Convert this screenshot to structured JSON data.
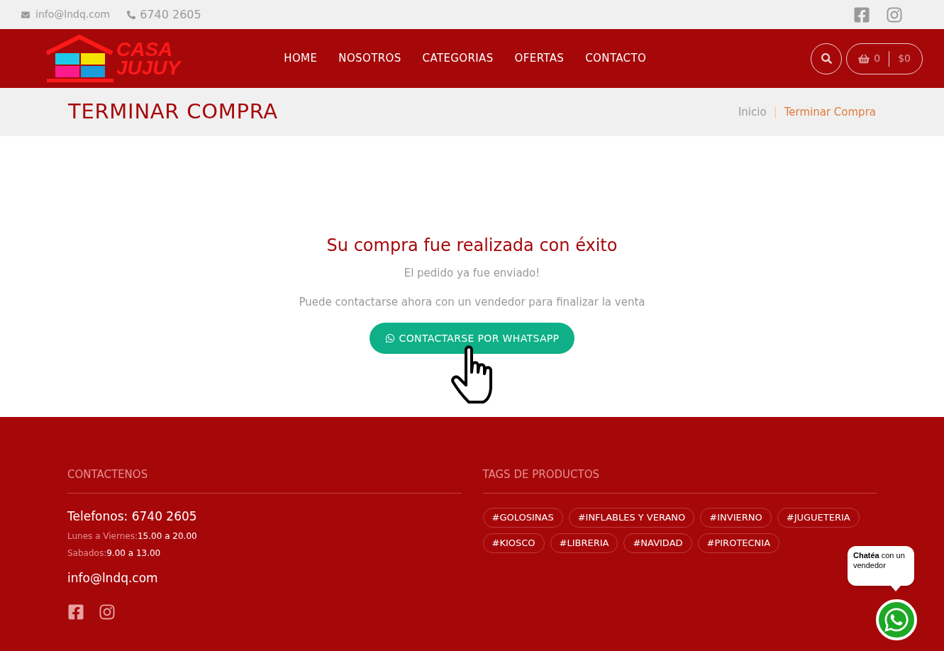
{
  "topbar": {
    "email": "info@lndq.com",
    "phone": "6740 2605"
  },
  "header": {
    "logo": [
      "CASA",
      "JUJUY"
    ],
    "nav": [
      {
        "label": "HOME"
      },
      {
        "label": "NOSOTROS"
      },
      {
        "label": "CATEGORIAS"
      },
      {
        "label": "OFERTAS"
      },
      {
        "label": "CONTACTO"
      }
    ],
    "cart": {
      "count": "0",
      "total": "$0"
    }
  },
  "page_title": "TERMINAR COMPRA",
  "breadcrumb": [
    {
      "label": "Inicio",
      "selected": false
    },
    {
      "label": "Terminar Compra",
      "selected": true
    }
  ],
  "breadcrumb_separator": "|",
  "message": {
    "title": "Su compra fue realizada con éxito",
    "line_1": "El pedido ya fue enviado!",
    "line_2": "Puede contactarse ahora con un vendedor para finalizar la venta",
    "button": "CONTACTARSE POR WHATSAPP"
  },
  "footer": {
    "contact_heading": "CONTACTENOS",
    "phones": "Telefonos: 6740 2605",
    "hours": [
      {
        "label": "Lunes a Viernes:",
        "value": "15.00 a 20.00"
      },
      {
        "label": "Sabados:",
        "value": "9.00 a 13.00"
      }
    ],
    "email": "info@lndq.com",
    "tags_heading": "TAGS DE PRODUCTOS",
    "tags": [
      "#GOLOSINAS",
      "#INFLABLES Y VERANO",
      "#INVIERNO",
      "#JUGUETERIA",
      "#KIOSCO",
      "#LIBRERIA",
      "#NAVIDAD",
      "#PIROTECNIA"
    ]
  },
  "chat_bubble": "**Chatéa** con un vendedor"
}
